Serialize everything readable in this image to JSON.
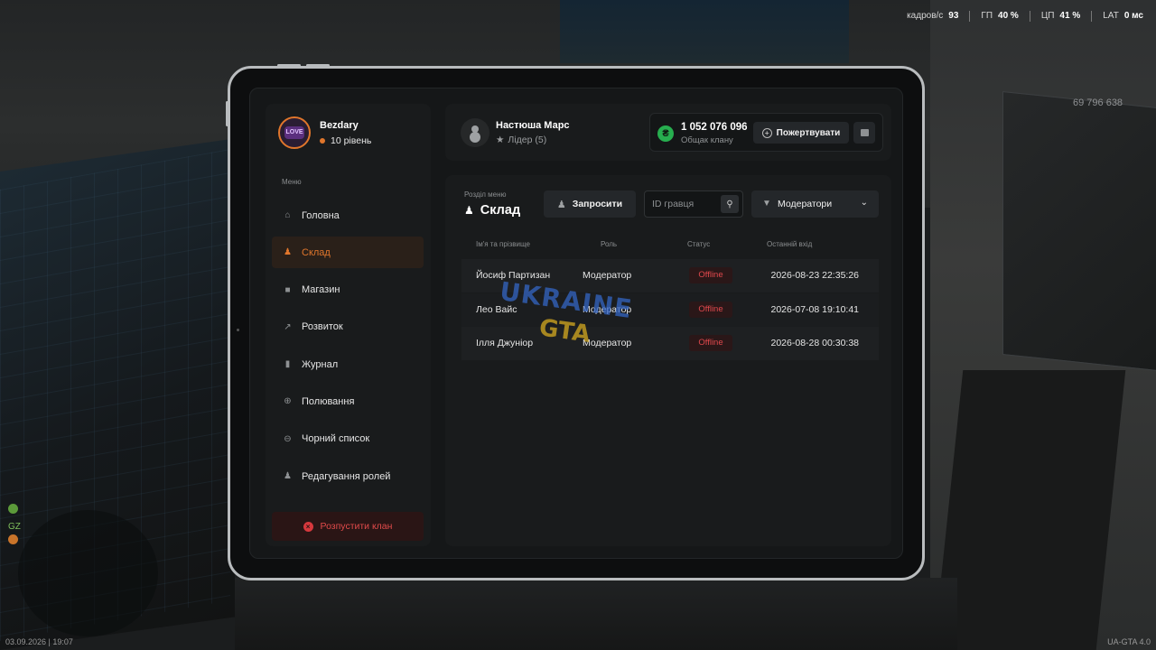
{
  "hud": {
    "fps_label": "кадров/с",
    "fps_value": "93",
    "gpu_label": "ГП",
    "gpu_value": "40 %",
    "cpu_label": "ЦП",
    "cpu_value": "41 %",
    "lat_label": "LAT",
    "lat_value": "0 мс"
  },
  "game": {
    "online_count": "69 796 638",
    "build": "UA-GTA 4.0",
    "datetime": "03.09.2026 | 19:07"
  },
  "sidebar": {
    "clan_name": "Bezdary",
    "clan_logo_text": "LOVE",
    "level": "10 рівень",
    "menu_label": "Меню",
    "items": [
      {
        "label": "Головна",
        "icon": "home-icon",
        "active": false
      },
      {
        "label": "Склад",
        "icon": "people-icon",
        "active": true
      },
      {
        "label": "Магазин",
        "icon": "shop-icon",
        "active": false
      },
      {
        "label": "Розвиток",
        "icon": "chart-icon",
        "active": false
      },
      {
        "label": "Журнал",
        "icon": "book-icon",
        "active": false
      },
      {
        "label": "Полювання",
        "icon": "crosshair-icon",
        "active": false
      },
      {
        "label": "Чорний список",
        "icon": "block-icon",
        "active": false
      },
      {
        "label": "Редагування ролей",
        "icon": "user-icon",
        "active": false
      }
    ],
    "disband_label": "Розпустити клан"
  },
  "leader": {
    "name": "Настюша Марс",
    "role": "Лідер (5)"
  },
  "fund": {
    "amount": "1 052 076 096",
    "label": "Общак клану",
    "donate_label": "Пожертвувати"
  },
  "section": {
    "caption": "Розділ меню",
    "title": "Склад",
    "invite_label": "Запросити",
    "search_placeholder": "ID гравця",
    "filter_value": "Модератори"
  },
  "table": {
    "headers": [
      "Ім'я та прізвище",
      "Роль",
      "Статус",
      "Останній вхід"
    ],
    "rows": [
      {
        "name": "Йосиф Партизан",
        "role": "Модератор",
        "status": "Offline",
        "last": "2026-08-23 22:35:26"
      },
      {
        "name": "Лео Вайс",
        "role": "Модератор",
        "status": "Offline",
        "last": "2026-07-08 19:10:41"
      },
      {
        "name": "Ілля Джуніор",
        "role": "Модератор",
        "status": "Offline",
        "last": "2026-08-28 00:30:38"
      }
    ]
  },
  "watermark": {
    "line1": "UKRAINE",
    "line2": "GTA"
  },
  "colors": {
    "accent": "#e0762c",
    "danger": "#e0484d",
    "money": "#27ae4f"
  }
}
